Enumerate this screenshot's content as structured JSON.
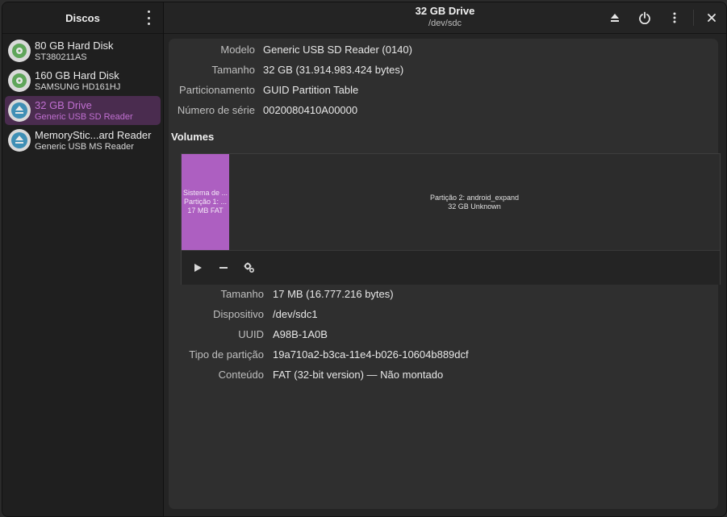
{
  "sidebar": {
    "title": "Discos",
    "items": [
      {
        "name": "80 GB Hard Disk",
        "sub": "ST380211AS",
        "icon": "hard-disk-icon"
      },
      {
        "name": "160 GB Hard Disk",
        "sub": "SAMSUNG HD161HJ",
        "icon": "hard-disk-icon"
      },
      {
        "name": "32 GB Drive",
        "sub": "Generic USB SD Reader",
        "icon": "eject-drive-icon"
      },
      {
        "name": "MemoryStic...ard Reader",
        "sub": "Generic USB MS Reader",
        "icon": "eject-drive-icon"
      }
    ]
  },
  "header": {
    "title": "32 GB Drive",
    "subtitle": "/dev/sdc"
  },
  "drive": {
    "model_label": "Modelo",
    "model": "Generic USB SD Reader (0140)",
    "size_label": "Tamanho",
    "size": "32 GB (31.914.983.424 bytes)",
    "partitioning_label": "Particionamento",
    "partitioning": "GUID Partition Table",
    "serial_label": "Número de série",
    "serial": "0020080410A00000"
  },
  "volumes": {
    "title": "Volumes",
    "partition1": {
      "line1": "Sistema de ...",
      "line2": "Partição 1: ...",
      "line3": "17 MB FAT"
    },
    "partition2": {
      "line1": "Partição 2: android_expand",
      "line2": "32 GB Unknown"
    }
  },
  "partition": {
    "size_label": "Tamanho",
    "size": "17 MB (16.777.216 bytes)",
    "device_label": "Dispositivo",
    "device": "/dev/sdc1",
    "uuid_label": "UUID",
    "uuid": "A98B-1A0B",
    "type_label": "Tipo de partição",
    "type": "19a710a2-b3ca-11e4-b026-10604b889dcf",
    "contents_label": "Conteúdo",
    "contents": "FAT (32-bit version) — Não montado"
  },
  "colors": {
    "accent": "#ad5fc1",
    "selected_bg": "#4a2c4f",
    "selected_text": "#c06fd1",
    "hdd_icon": "#5fa55a",
    "usb_icon": "#3f8fb5"
  }
}
